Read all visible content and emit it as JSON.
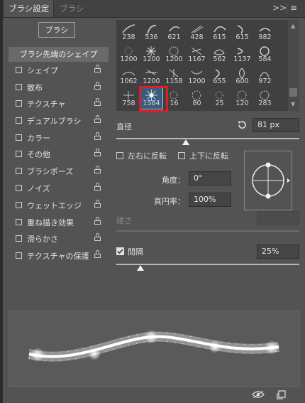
{
  "tabs": [
    "ブラシ設定",
    "ブラシ"
  ],
  "header_icons": [
    "expand-icon",
    "menu-icon"
  ],
  "preset_button": "ブラシ",
  "brush_tip_shape": "ブラシ先端のシェイプ",
  "options": [
    {
      "label": "シェイプ",
      "checked": false
    },
    {
      "label": "散布",
      "checked": false
    },
    {
      "label": "テクスチャ",
      "checked": false
    },
    {
      "label": "デュアルブラシ",
      "checked": false
    },
    {
      "label": "カラー",
      "checked": false
    },
    {
      "label": "その他",
      "checked": false
    },
    {
      "label": "ブラシポーズ",
      "checked": false
    },
    {
      "label": "ノイズ",
      "checked": false
    },
    {
      "label": "ウェットエッジ",
      "checked": false
    },
    {
      "label": "重ね描き効果",
      "checked": false
    },
    {
      "label": "滑らかさ",
      "checked": false
    },
    {
      "label": "テクスチャの保護",
      "checked": false
    }
  ],
  "brush_rows": [
    [
      "238",
      "536",
      "621",
      "428",
      "615",
      "615",
      "982"
    ],
    [
      "1200",
      "1200",
      "1200",
      "1167",
      "562",
      "1137",
      "584"
    ],
    [
      "1062",
      "1200",
      "1158",
      "1200",
      "655",
      "600",
      "972"
    ],
    [
      "758",
      "1584",
      "16",
      "80",
      "25",
      "120",
      "283"
    ]
  ],
  "selected_brush": "1584",
  "diameter": {
    "label": "直径",
    "value": "81 px",
    "slider_fraction": 0.38
  },
  "flip_x": "左右に反転",
  "flip_y": "上下に反転",
  "angle": {
    "label": "角度：",
    "value": "0°"
  },
  "roundness": {
    "label": "真円率：",
    "value": "100%"
  },
  "hardness": {
    "label": "硬さ"
  },
  "spacing": {
    "label": "間隔",
    "value": "25%",
    "checked": true,
    "slider_fraction": 0.13
  },
  "footer_icons": [
    "eye-icon",
    "new-preset-icon"
  ],
  "colors": {
    "panel": "#535353",
    "accent_red": "#e01c24",
    "selected": "#3a5d7c"
  }
}
